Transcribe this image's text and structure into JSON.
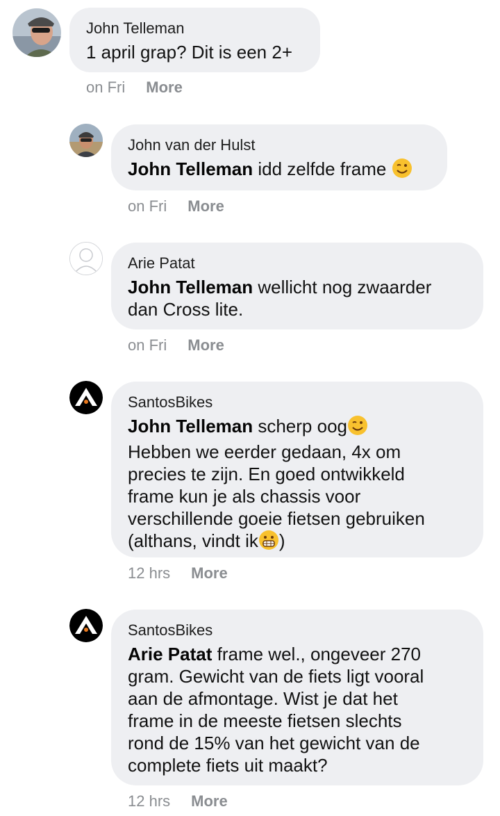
{
  "comments": [
    {
      "author": "John Telleman",
      "mention": "",
      "text": "1 april grap? Dit is een 2+",
      "time": "on Fri",
      "more": "More",
      "avatar_icon": "person-photo-icon"
    },
    {
      "author": "John van der Hulst",
      "mention": "John Telleman",
      "text": "idd zelfde frame",
      "time": "on Fri",
      "more": "More",
      "avatar_icon": "person-photo-icon",
      "emoji": "wink-emoji-icon"
    },
    {
      "author": "Arie Patat",
      "mention": "John Telleman",
      "text_line1": "wellicht nog zwaarder",
      "text_line2": "dan Cross lite.",
      "time": "on Fri",
      "more": "More",
      "avatar_icon": "default-profile-icon"
    },
    {
      "author": "SantosBikes",
      "mention": "John Telleman",
      "text_l1": "scherp oog",
      "text_l2": "Hebben we eerder gedaan, 4x om",
      "text_l3": "precies te zijn. En goed ontwikkeld",
      "text_l4": "frame kun je als chassis voor",
      "text_l5": "verschillende goeie fietsen gebruiken",
      "text_l6a": "(althans, vindt ik",
      "text_l6b": ")",
      "time": "12 hrs",
      "more": "More",
      "avatar_icon": "santos-logo-icon"
    },
    {
      "author": "SantosBikes",
      "mention": "Arie Patat",
      "text_l1": "frame wel., ongeveer 270",
      "text_l2": "gram. Gewicht van de fiets ligt vooral",
      "text_l3": "aan de afmontage. Wist je dat het",
      "text_l4": "frame in de meeste fietsen slechts",
      "text_l5": "rond de 15% van het gewicht van de",
      "text_l6": "complete fiets uit maakt?",
      "time": "12 hrs",
      "more": "More",
      "avatar_icon": "santos-logo-icon"
    }
  ]
}
